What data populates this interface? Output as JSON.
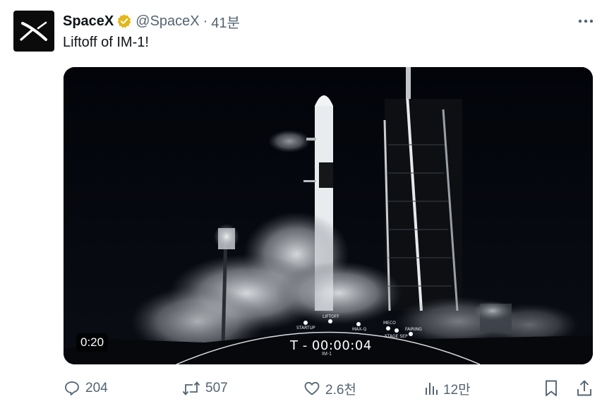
{
  "tweet": {
    "author": {
      "display_name": "SpaceX",
      "handle": "@SpaceX",
      "time_ago": "41분",
      "avatar_icon": "spacex-logo-icon",
      "verified_icon": "gold-verified-badge-icon"
    },
    "separator": "·",
    "text": "Liftoff of IM-1!",
    "more_icon": "more-dots-icon",
    "media": {
      "duration": "0:20",
      "countdown": "T - 00:00:04",
      "mission": "IM-1",
      "stages": [
        "STARTUP",
        "LIFTOFF",
        "MAX-Q",
        "MECO",
        "STAGE SEP",
        "FAIRING"
      ],
      "play_icon": null
    },
    "actions": {
      "reply": {
        "count": "204",
        "icon": "reply-icon"
      },
      "repost": {
        "count": "507",
        "icon": "repost-icon"
      },
      "like": {
        "count": "2.6천",
        "icon": "like-heart-icon"
      },
      "views": {
        "count": "12만",
        "icon": "views-chart-icon"
      },
      "bookmark": {
        "icon": "bookmark-icon"
      },
      "share": {
        "icon": "share-icon"
      }
    }
  },
  "colors": {
    "text_primary": "#0f1419",
    "text_secondary": "#536471",
    "verified_gold": "#e2b719",
    "media_bg": "#03050a"
  }
}
